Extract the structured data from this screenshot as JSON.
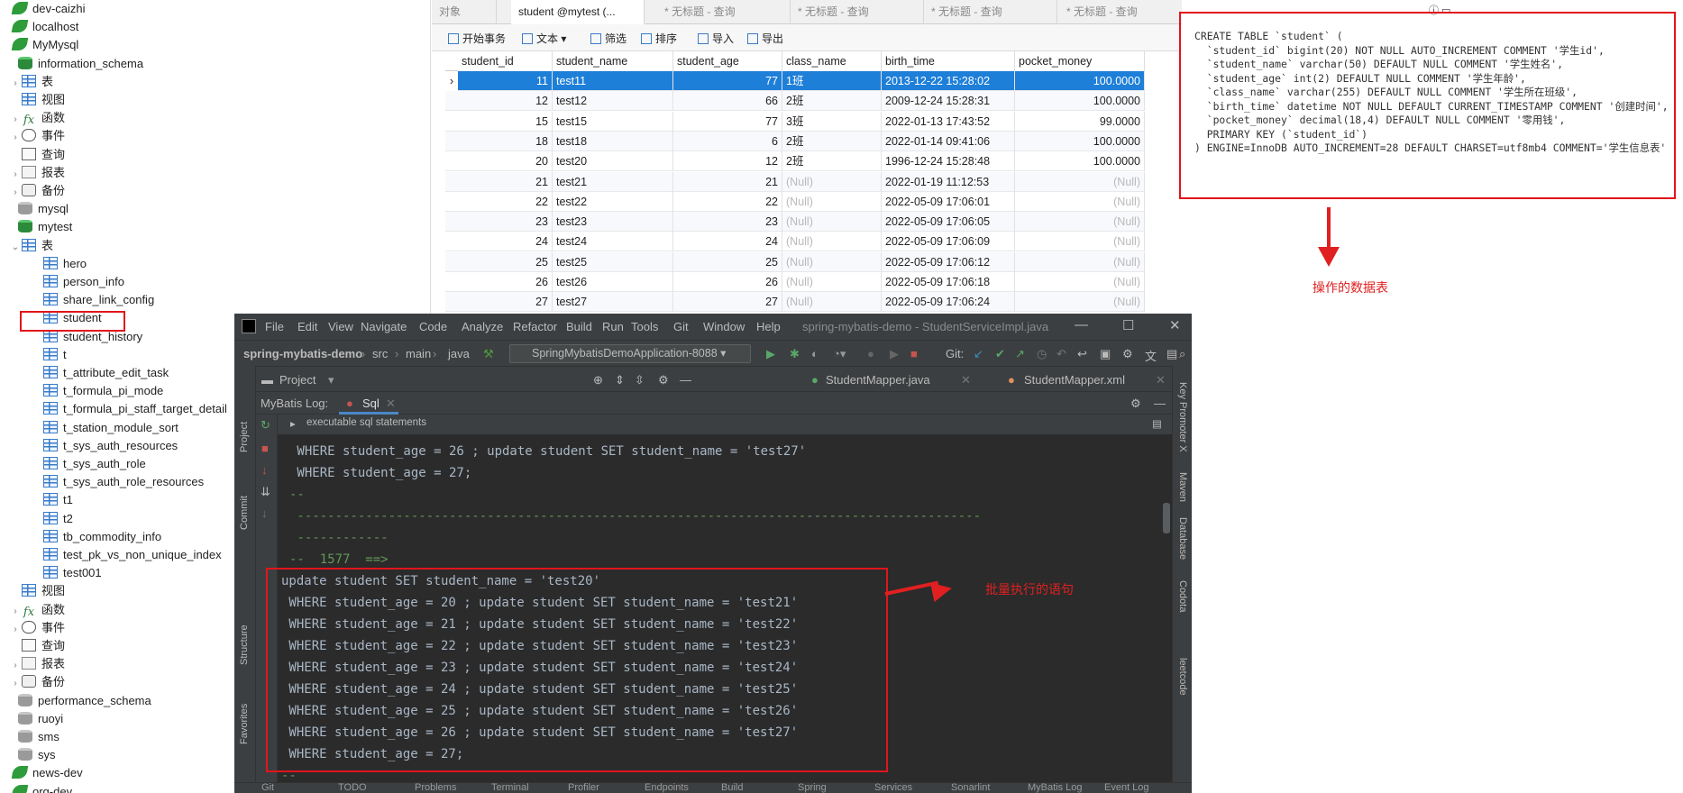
{
  "tree": {
    "items": [
      {
        "label": "dev-caizhi",
        "icon": "connection-icon",
        "indent": 0,
        "arrow": ""
      },
      {
        "label": "localhost",
        "icon": "connection-icon",
        "indent": 0,
        "arrow": ""
      },
      {
        "label": "MyMysql",
        "icon": "connection-icon",
        "indent": 0,
        "arrow": ""
      },
      {
        "label": "information_schema",
        "icon": "database-icon",
        "indent": 1,
        "arrow": ""
      },
      {
        "label": "表",
        "icon": "table-icon",
        "indent": 2,
        "arrow": "›"
      },
      {
        "label": "视图",
        "icon": "table-icon",
        "indent": 2,
        "arrow": ""
      },
      {
        "label": "函数",
        "icon": "function-icon",
        "indent": 2,
        "arrow": "›"
      },
      {
        "label": "事件",
        "icon": "event-icon",
        "indent": 2,
        "arrow": "›"
      },
      {
        "label": "查询",
        "icon": "query-icon",
        "indent": 2,
        "arrow": ""
      },
      {
        "label": "报表",
        "icon": "report-icon",
        "indent": 2,
        "arrow": "›"
      },
      {
        "label": "备份",
        "icon": "backup-icon",
        "indent": 2,
        "arrow": "›"
      },
      {
        "label": "mysql",
        "icon": "database-gray-icon",
        "indent": 1,
        "arrow": ""
      },
      {
        "label": "mytest",
        "icon": "database-icon",
        "indent": 1,
        "arrow": ""
      },
      {
        "label": "表",
        "icon": "table-icon",
        "indent": 2,
        "arrow": "⌄"
      },
      {
        "label": "hero",
        "icon": "table-icon",
        "indent": 3,
        "arrow": ""
      },
      {
        "label": "person_info",
        "icon": "table-icon",
        "indent": 3,
        "arrow": ""
      },
      {
        "label": "share_link_config",
        "icon": "table-icon",
        "indent": 3,
        "arrow": ""
      },
      {
        "label": "student",
        "icon": "table-icon",
        "indent": 3,
        "arrow": ""
      },
      {
        "label": "student_history",
        "icon": "table-icon",
        "indent": 3,
        "arrow": ""
      },
      {
        "label": "t",
        "icon": "table-icon",
        "indent": 3,
        "arrow": ""
      },
      {
        "label": "t_attribute_edit_task",
        "icon": "table-icon",
        "indent": 3,
        "arrow": ""
      },
      {
        "label": "t_formula_pi_mode",
        "icon": "table-icon",
        "indent": 3,
        "arrow": ""
      },
      {
        "label": "t_formula_pi_staff_target_detail",
        "icon": "table-icon",
        "indent": 3,
        "arrow": ""
      },
      {
        "label": "t_station_module_sort",
        "icon": "table-icon",
        "indent": 3,
        "arrow": ""
      },
      {
        "label": "t_sys_auth_resources",
        "icon": "table-icon",
        "indent": 3,
        "arrow": ""
      },
      {
        "label": "t_sys_auth_role",
        "icon": "table-icon",
        "indent": 3,
        "arrow": ""
      },
      {
        "label": "t_sys_auth_role_resources",
        "icon": "table-icon",
        "indent": 3,
        "arrow": ""
      },
      {
        "label": "t1",
        "icon": "table-icon",
        "indent": 3,
        "arrow": ""
      },
      {
        "label": "t2",
        "icon": "table-icon",
        "indent": 3,
        "arrow": ""
      },
      {
        "label": "tb_commodity_info",
        "icon": "table-icon",
        "indent": 3,
        "arrow": ""
      },
      {
        "label": "test_pk_vs_non_unique_index",
        "icon": "table-icon",
        "indent": 3,
        "arrow": ""
      },
      {
        "label": "test001",
        "icon": "table-icon",
        "indent": 3,
        "arrow": ""
      },
      {
        "label": "视图",
        "icon": "table-icon",
        "indent": 2,
        "arrow": ""
      },
      {
        "label": "函数",
        "icon": "function-icon",
        "indent": 2,
        "arrow": "›"
      },
      {
        "label": "事件",
        "icon": "event-icon",
        "indent": 2,
        "arrow": "›"
      },
      {
        "label": "查询",
        "icon": "query-icon",
        "indent": 2,
        "arrow": ""
      },
      {
        "label": "报表",
        "icon": "report-icon",
        "indent": 2,
        "arrow": "›"
      },
      {
        "label": "备份",
        "icon": "backup-icon",
        "indent": 2,
        "arrow": "›"
      },
      {
        "label": "performance_schema",
        "icon": "database-gray-icon",
        "indent": 1,
        "arrow": ""
      },
      {
        "label": "ruoyi",
        "icon": "database-gray-icon",
        "indent": 1,
        "arrow": ""
      },
      {
        "label": "sms",
        "icon": "database-gray-icon",
        "indent": 1,
        "arrow": ""
      },
      {
        "label": "sys",
        "icon": "database-gray-icon",
        "indent": 1,
        "arrow": ""
      },
      {
        "label": "news-dev",
        "icon": "connection-icon",
        "indent": 0,
        "arrow": ""
      },
      {
        "label": "org-dev",
        "icon": "connection-icon",
        "indent": 0,
        "arrow": ""
      }
    ]
  },
  "tabs": [
    {
      "label": "对象",
      "active": false
    },
    {
      "label": "student @mytest (...",
      "active": true
    },
    {
      "label": "* 无标题 - 查询",
      "active": false
    },
    {
      "label": "* 无标题 - 查询",
      "active": false
    },
    {
      "label": "* 无标题 - 查询",
      "active": false
    },
    {
      "label": "* 无标题 - 查询",
      "active": false
    }
  ],
  "toolbar": {
    "begin_tx": "开始事务",
    "text": "文本",
    "filter": "筛选",
    "sort": "排序",
    "import": "导入",
    "export": "导出"
  },
  "grid": {
    "columns": [
      "student_id",
      "student_name",
      "student_age",
      "class_name",
      "birth_time",
      "pocket_money"
    ],
    "rows": [
      [
        "11",
        "test11",
        "77",
        "1班",
        "2013-12-22 15:28:02",
        "100.0000"
      ],
      [
        "12",
        "test12",
        "66",
        "2班",
        "2009-12-24 15:28:31",
        "100.0000"
      ],
      [
        "15",
        "test15",
        "77",
        "3班",
        "2022-01-13 17:43:52",
        "99.0000"
      ],
      [
        "18",
        "test18",
        "6",
        "2班",
        "2022-01-14 09:41:06",
        "100.0000"
      ],
      [
        "20",
        "test20",
        "12",
        "2班",
        "1996-12-24 15:28:48",
        "100.0000"
      ],
      [
        "21",
        "test21",
        "21",
        "(Null)",
        "2022-01-19 11:12:53",
        "(Null)"
      ],
      [
        "22",
        "test22",
        "22",
        "(Null)",
        "2022-05-09 17:06:01",
        "(Null)"
      ],
      [
        "23",
        "test23",
        "23",
        "(Null)",
        "2022-05-09 17:06:05",
        "(Null)"
      ],
      [
        "24",
        "test24",
        "24",
        "(Null)",
        "2022-05-09 17:06:09",
        "(Null)"
      ],
      [
        "25",
        "test25",
        "25",
        "(Null)",
        "2022-05-09 17:06:12",
        "(Null)"
      ],
      [
        "26",
        "test26",
        "26",
        "(Null)",
        "2022-05-09 17:06:18",
        "(Null)"
      ],
      [
        "27",
        "test27",
        "27",
        "(Null)",
        "2022-05-09 17:06:24",
        "(Null)"
      ]
    ],
    "selected_row": 0,
    "row_marker": "›"
  },
  "ddl": {
    "lines": [
      "CREATE TABLE `student` (",
      "  `student_id` bigint(20) NOT NULL AUTO_INCREMENT COMMENT '学生id',",
      "  `student_name` varchar(50) DEFAULT NULL COMMENT '学生姓名',",
      "  `student_age` int(2) DEFAULT NULL COMMENT '学生年龄',",
      "  `class_name` varchar(255) DEFAULT NULL COMMENT '学生所在班级',",
      "  `birth_time` datetime NOT NULL DEFAULT CURRENT_TIMESTAMP COMMENT '创建时间',",
      "  `pocket_money` decimal(18,4) DEFAULT NULL COMMENT '零用钱',",
      "  PRIMARY KEY (`student_id`)",
      ") ENGINE=InnoDB AUTO_INCREMENT=28 DEFAULT CHARSET=utf8mb4 COMMENT='学生信息表'"
    ],
    "top_icons": "ⓘ ▭"
  },
  "annotations": {
    "table_label": "操作的数据表",
    "batch_label": "批量执行的语句",
    "color": "#e02020"
  },
  "idea": {
    "menus": [
      "File",
      "Edit",
      "View",
      "Navigate",
      "Code",
      "Analyze",
      "Refactor",
      "Build",
      "Run",
      "Tools",
      "Git",
      "Window",
      "Help"
    ],
    "window_title": "spring-mybatis-demo - StudentServiceImpl.java",
    "window_controls": [
      "—",
      "☐",
      "✕"
    ],
    "breadcrumbs": [
      "spring-mybatis-demo",
      "src",
      "main",
      "java"
    ],
    "run_config": "SpringMybatisDemoApplication-8088",
    "git_label": "Git:",
    "project_label": "Project",
    "editor_tabs": [
      "StudentMapper.java",
      "StudentMapper.xml"
    ],
    "mybatis_label": "MyBatis Log:",
    "sql_tab": "Sql",
    "exec_label": "executable sql statements",
    "left_strip": [
      "Project",
      "Commit",
      "Structure",
      "Favorites"
    ],
    "right_strip": [
      "Key Promoter X",
      "Maven",
      "Database",
      "Codota",
      "leetcode"
    ],
    "console_lines": [
      {
        "text": " WHERE student_age = 26 ; update student SET student_name = 'test27'",
        "cls": ""
      },
      {
        "text": " WHERE student_age = 27;",
        "cls": ""
      },
      {
        "text": "--",
        "cls": "green"
      },
      {
        "text": " ------------------------------------------------------------------------------------------",
        "cls": "green"
      },
      {
        "text": " ------------",
        "cls": "green"
      },
      {
        "text": "--  1577  ==>",
        "cls": "green"
      },
      {
        "text": "update student SET student_name = 'test20'",
        "cls": ""
      },
      {
        "text": " WHERE student_age = 20 ; update student SET student_name = 'test21'",
        "cls": ""
      },
      {
        "text": " WHERE student_age = 21 ; update student SET student_name = 'test22'",
        "cls": ""
      },
      {
        "text": " WHERE student_age = 22 ; update student SET student_name = 'test23'",
        "cls": ""
      },
      {
        "text": " WHERE student_age = 23 ; update student SET student_name = 'test24'",
        "cls": ""
      },
      {
        "text": " WHERE student_age = 24 ; update student SET student_name = 'test25'",
        "cls": ""
      },
      {
        "text": " WHERE student_age = 25 ; update student SET student_name = 'test26'",
        "cls": ""
      },
      {
        "text": " WHERE student_age = 26 ; update student SET student_name = 'test27'",
        "cls": ""
      },
      {
        "text": " WHERE student_age = 27;",
        "cls": ""
      },
      {
        "text": "--",
        "cls": "green"
      }
    ],
    "bottom_tabs": [
      "Git",
      "TODO",
      "Problems",
      "Terminal",
      "Profiler",
      "Endpoints",
      "Build",
      "Spring",
      "Services",
      "Sonarlint",
      "MyBatis Log",
      "Event Log"
    ]
  }
}
